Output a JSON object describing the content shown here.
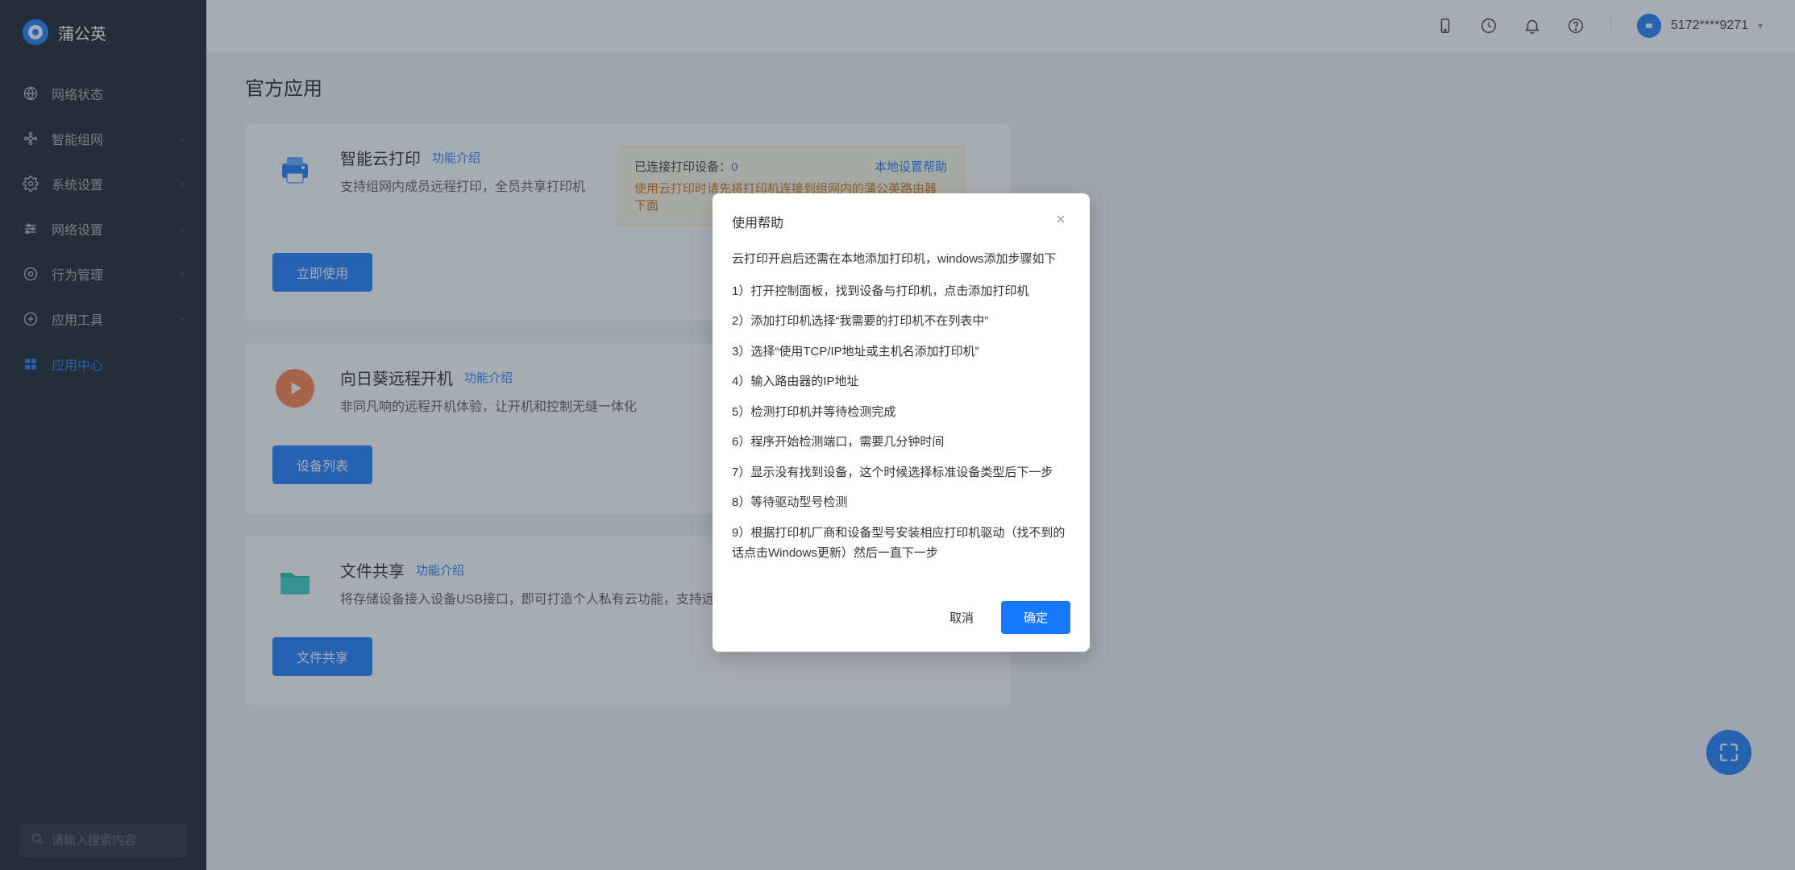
{
  "brand": {
    "name": "蒲公英"
  },
  "sidebar": {
    "items": [
      {
        "label": "网络状态",
        "hasChevron": false
      },
      {
        "label": "智能组网",
        "hasChevron": true
      },
      {
        "label": "系统设置",
        "hasChevron": true
      },
      {
        "label": "网络设置",
        "hasChevron": true
      },
      {
        "label": "行为管理",
        "hasChevron": true
      },
      {
        "label": "应用工具",
        "hasChevron": true
      },
      {
        "label": "应用中心",
        "hasChevron": false
      }
    ],
    "search_placeholder": "请输入搜索内容"
  },
  "header": {
    "user_label": "5172****9271"
  },
  "page": {
    "title": "官方应用"
  },
  "cards": [
    {
      "title": "智能云打印",
      "intro_link": "功能介绍",
      "desc": "支持组网内成员远程打印，全员共享打印机",
      "button": "立即使用",
      "note": {
        "connected_label": "已连接打印设备：",
        "connected_count": "0",
        "help": "本地设置帮助",
        "warning": "使用云打印时请先将打印机连接到组网内的蒲公英路由器下面"
      }
    },
    {
      "title": "向日葵远程开机",
      "intro_link": "功能介绍",
      "desc": "非同凡响的远程开机体验，让开机和控制无缝一体化",
      "button": "设备列表"
    },
    {
      "title": "文件共享",
      "intro_link": "功能介绍",
      "desc": "将存储设备接入设备USB接口，即可打造个人私有云功能，支持远程",
      "button": "文件共享"
    }
  ],
  "modal": {
    "title": "使用帮助",
    "intro": "云打印开启后还需在本地添加打印机，windows添加步骤如下",
    "steps": [
      "1）打开控制面板，找到设备与打印机，点击添加打印机",
      "2）添加打印机选择“我需要的打印机不在列表中”",
      "3）选择“使用TCP/IP地址或主机名添加打印机”",
      "4）输入路由器的IP地址",
      "5）检测打印机并等待检测完成",
      "6）程序开始检测端口，需要几分钟时间",
      "7）显示没有找到设备，这个时候选择标准设备类型后下一步",
      "8）等待驱动型号检测",
      "9）根据打印机厂商和设备型号安装相应打印机驱动（找不到的话点击Windows更新）然后一直下一步"
    ],
    "cancel": "取消",
    "confirm": "确定"
  }
}
